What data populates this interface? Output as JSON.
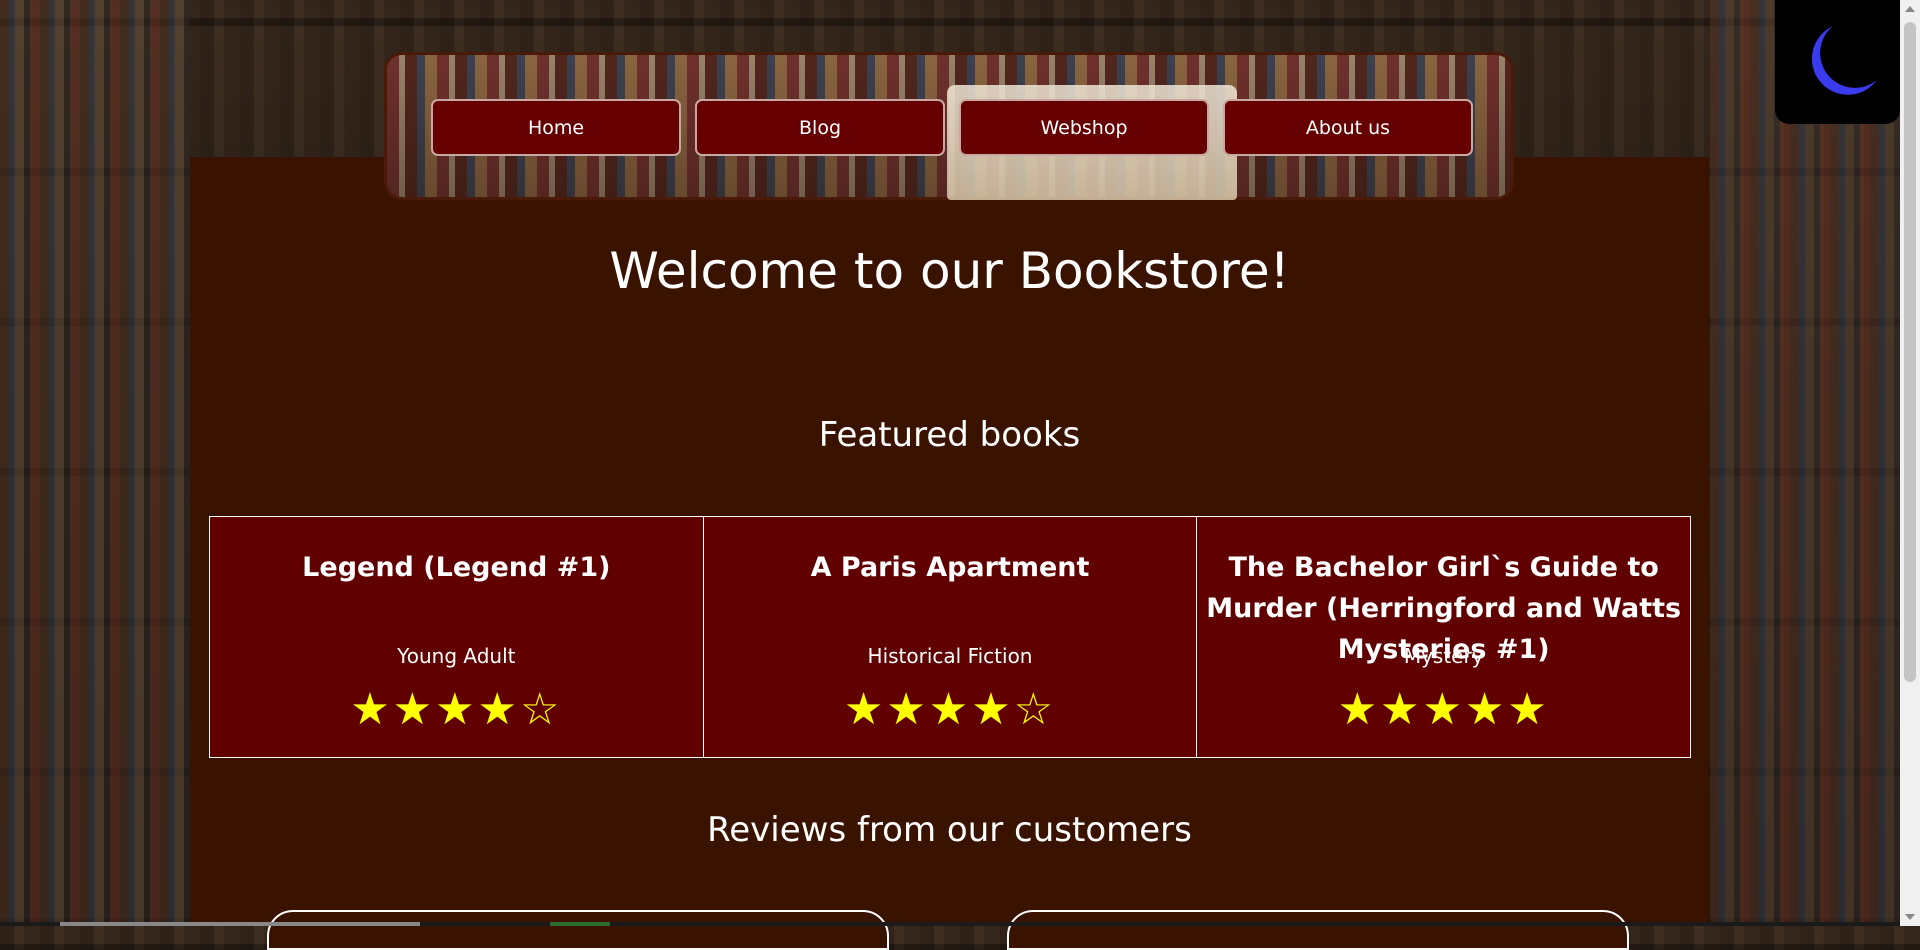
{
  "nav": {
    "items": [
      {
        "label": "Home"
      },
      {
        "label": "Blog"
      },
      {
        "label": "Webshop"
      },
      {
        "label": "About us"
      }
    ]
  },
  "theme_toggle": {
    "icon": "moon-icon",
    "color": "#3a3aee"
  },
  "hero": {
    "title": "Welcome to our Bookstore!"
  },
  "featured": {
    "title": "Featured books",
    "books": [
      {
        "title": "Legend (Legend #1)",
        "genre": "Young Adult",
        "rating": 4,
        "stars": "★★★★☆"
      },
      {
        "title": "A Paris Apartment",
        "genre": "Historical Fiction",
        "rating": 4,
        "stars": "★★★★☆"
      },
      {
        "title": "The Bachelor Girl`s Guide to Murder (Herringford and Watts Mysteries #1)",
        "genre": "Mystery",
        "rating": 5,
        "stars": "★★★★★"
      }
    ]
  },
  "reviews": {
    "title": "Reviews from our customers"
  },
  "colors": {
    "content_bg": "#3a1300",
    "card_bg": "#600000",
    "nav_button_bg": "#660000",
    "star": "#ffff00"
  }
}
